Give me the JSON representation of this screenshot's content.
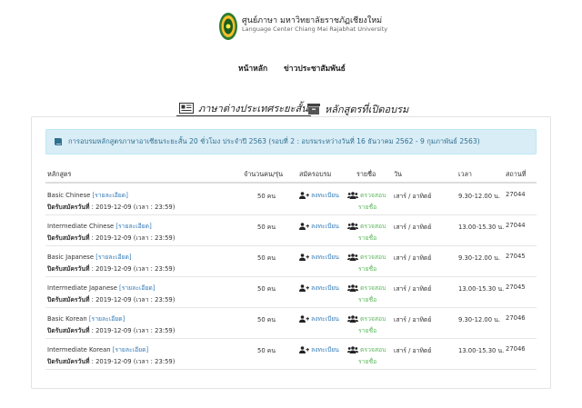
{
  "header": {
    "title_th": "ศูนย์ภาษา มหาวิทยาลัยราชภัฏเชียงใหม่",
    "title_en": "Language Center Chiang Mai Rajabhat University"
  },
  "nav": {
    "home": "หน้าหลัก",
    "news": "ข่าวประชาสัมพันธ์"
  },
  "tabs": [
    {
      "label": "ภาษาต่างประเทศระยะสั้น",
      "active": true,
      "icon": "newspaper-icon"
    },
    {
      "label": "หลักสูตรที่เปิดอบรม",
      "active": false,
      "icon": "archive-icon"
    }
  ],
  "info": {
    "text": "การอบรมหลักสูตรภาษาอาเซียนระยะสั้น 20 ชั่วโมง ประจำปี 2563 (รอบที่ 2 : อบรมระหว่างวันที่ 16 ธันวาคม 2562 - 9 กุมภาพันธ์ 2563)"
  },
  "table": {
    "headers": [
      "หลักสูตร",
      "จำนวนคน/รุ่น",
      "สมัครอบรม",
      "รายชื่อ",
      "วัน",
      "เวลา",
      "สถานที่"
    ],
    "rows": [
      {
        "course": "Basic Chinese",
        "detail_link": "[รายละเอียด]",
        "deadline_label": "ปิดรับสมัครวันที่",
        "deadline_value": " : 2019-12-09 (เวลา : 23:59)",
        "count": "50 คน",
        "register": "ลงทะเบียน",
        "check": "ตรวจสอบ",
        "check2": "รายชื่อ",
        "day": "เสาร์ / อาทิตย์",
        "time": "9.30-12.00 น.",
        "room": "27044"
      },
      {
        "course": "Intermediate Chinese",
        "detail_link": "[รายละเอียด]",
        "deadline_label": "ปิดรับสมัครวันที่",
        "deadline_value": " : 2019-12-09 (เวลา : 23:59)",
        "count": "50 คน",
        "register": "ลงทะเบียน",
        "check": "ตรวจสอบ",
        "check2": "รายชื่อ",
        "day": "เสาร์ / อาทิตย์",
        "time": "13.00-15.30 น.",
        "room": "27044"
      },
      {
        "course": "Basic Japanese",
        "detail_link": "[รายละเอียด]",
        "deadline_label": "ปิดรับสมัครวันที่",
        "deadline_value": " : 2019-12-09 (เวลา : 23:59)",
        "count": "50 คน",
        "register": "ลงทะเบียน",
        "check": "ตรวจสอบ",
        "check2": "รายชื่อ",
        "day": "เสาร์ / อาทิตย์",
        "time": "9.30-12.00 น.",
        "room": "27045"
      },
      {
        "course": "Intermediate Japanese",
        "detail_link": "[รายละเอียด]",
        "deadline_label": "ปิดรับสมัครวันที่",
        "deadline_value": " : 2019-12-09 (เวลา : 23:59)",
        "count": "50 คน",
        "register": "ลงทะเบียน",
        "check": "ตรวจสอบ",
        "check2": "รายชื่อ",
        "day": "เสาร์ / อาทิตย์",
        "time": "13.00-15.30 น.",
        "room": "27045"
      },
      {
        "course": "Basic Korean",
        "detail_link": "[รายละเอียด]",
        "deadline_label": "ปิดรับสมัครวันที่",
        "deadline_value": " : 2019-12-09 (เวลา : 23:59)",
        "count": "50 คน",
        "register": "ลงทะเบียน",
        "check": "ตรวจสอบ",
        "check2": "รายชื่อ",
        "day": "เสาร์ / อาทิตย์",
        "time": "9.30-12.00 น.",
        "room": "27046"
      },
      {
        "course": "Intermediate Korean",
        "detail_link": "[รายละเอียด]",
        "deadline_label": "ปิดรับสมัครวันที่",
        "deadline_value": " : 2019-12-09 (เวลา : 23:59)",
        "count": "50 คน",
        "register": "ลงทะเบียน",
        "check": "ตรวจสอบ",
        "check2": "รายชื่อ",
        "day": "เสาร์ / อาทิตย์",
        "time": "13.00-15.30 น.",
        "room": "27046"
      }
    ]
  },
  "colors": {
    "link": "#337ab7",
    "success": "#5cb85c",
    "info_bg": "#d9edf7",
    "info_text": "#31708f"
  }
}
